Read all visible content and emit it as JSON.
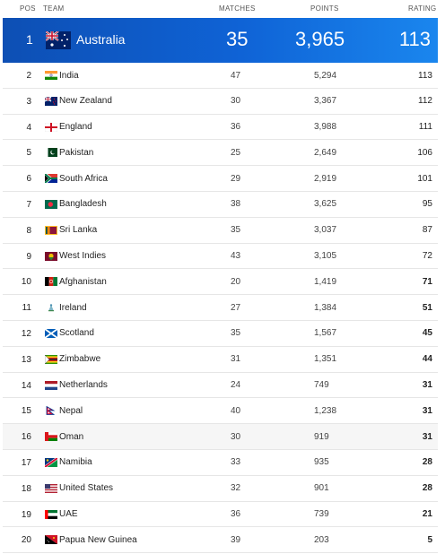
{
  "header": {
    "pos": "POS",
    "team": "TEAM",
    "matches": "MATCHES",
    "points": "POINTS",
    "rating": "RATING"
  },
  "top": {
    "pos": "1",
    "team": "Australia",
    "matches": "35",
    "points": "3,965",
    "rating": "113"
  },
  "rows": [
    {
      "pos": "2",
      "team": "India",
      "matches": "47",
      "points": "5,294",
      "rating": "113",
      "flag": "india-flag-icon"
    },
    {
      "pos": "3",
      "team": "New Zealand",
      "matches": "30",
      "points": "3,367",
      "rating": "112",
      "flag": "new-zealand-flag-icon"
    },
    {
      "pos": "4",
      "team": "England",
      "matches": "36",
      "points": "3,988",
      "rating": "111",
      "flag": "england-flag-icon"
    },
    {
      "pos": "5",
      "team": "Pakistan",
      "matches": "25",
      "points": "2,649",
      "rating": "106",
      "flag": "pakistan-flag-icon"
    },
    {
      "pos": "6",
      "team": "South Africa",
      "matches": "29",
      "points": "2,919",
      "rating": "101",
      "flag": "south-africa-flag-icon"
    },
    {
      "pos": "7",
      "team": "Bangladesh",
      "matches": "38",
      "points": "3,625",
      "rating": "95",
      "flag": "bangladesh-flag-icon"
    },
    {
      "pos": "8",
      "team": "Sri Lanka",
      "matches": "35",
      "points": "3,037",
      "rating": "87",
      "flag": "sri-lanka-flag-icon"
    },
    {
      "pos": "9",
      "team": "West Indies",
      "matches": "43",
      "points": "3,105",
      "rating": "72",
      "flag": "west-indies-flag-icon"
    },
    {
      "pos": "10",
      "team": "Afghanistan",
      "matches": "20",
      "points": "1,419",
      "rating": "71",
      "flag": "afghanistan-flag-icon"
    },
    {
      "pos": "11",
      "team": "Ireland",
      "matches": "27",
      "points": "1,384",
      "rating": "51",
      "flag": "ireland-flag-icon"
    },
    {
      "pos": "12",
      "team": "Scotland",
      "matches": "35",
      "points": "1,567",
      "rating": "45",
      "flag": "scotland-flag-icon"
    },
    {
      "pos": "13",
      "team": "Zimbabwe",
      "matches": "31",
      "points": "1,351",
      "rating": "44",
      "flag": "zimbabwe-flag-icon"
    },
    {
      "pos": "14",
      "team": "Netherlands",
      "matches": "24",
      "points": "749",
      "rating": "31",
      "flag": "netherlands-flag-icon"
    },
    {
      "pos": "15",
      "team": "Nepal",
      "matches": "40",
      "points": "1,238",
      "rating": "31",
      "flag": "nepal-flag-icon"
    },
    {
      "pos": "16",
      "team": "Oman",
      "matches": "30",
      "points": "919",
      "rating": "31",
      "flag": "oman-flag-icon"
    },
    {
      "pos": "17",
      "team": "Namibia",
      "matches": "33",
      "points": "935",
      "rating": "28",
      "flag": "namibia-flag-icon"
    },
    {
      "pos": "18",
      "team": "United States",
      "matches": "32",
      "points": "901",
      "rating": "28",
      "flag": "united-states-flag-icon"
    },
    {
      "pos": "19",
      "team": "UAE",
      "matches": "36",
      "points": "739",
      "rating": "21",
      "flag": "uae-flag-icon"
    },
    {
      "pos": "20",
      "team": "Papua New Guinea",
      "matches": "39",
      "points": "203",
      "rating": "5",
      "flag": "papua-new-guinea-flag-icon"
    }
  ],
  "colors": {
    "top_row_start": "#0d4fb4",
    "top_row_end": "#1a86ee",
    "row_divider": "#e6e6e6"
  }
}
